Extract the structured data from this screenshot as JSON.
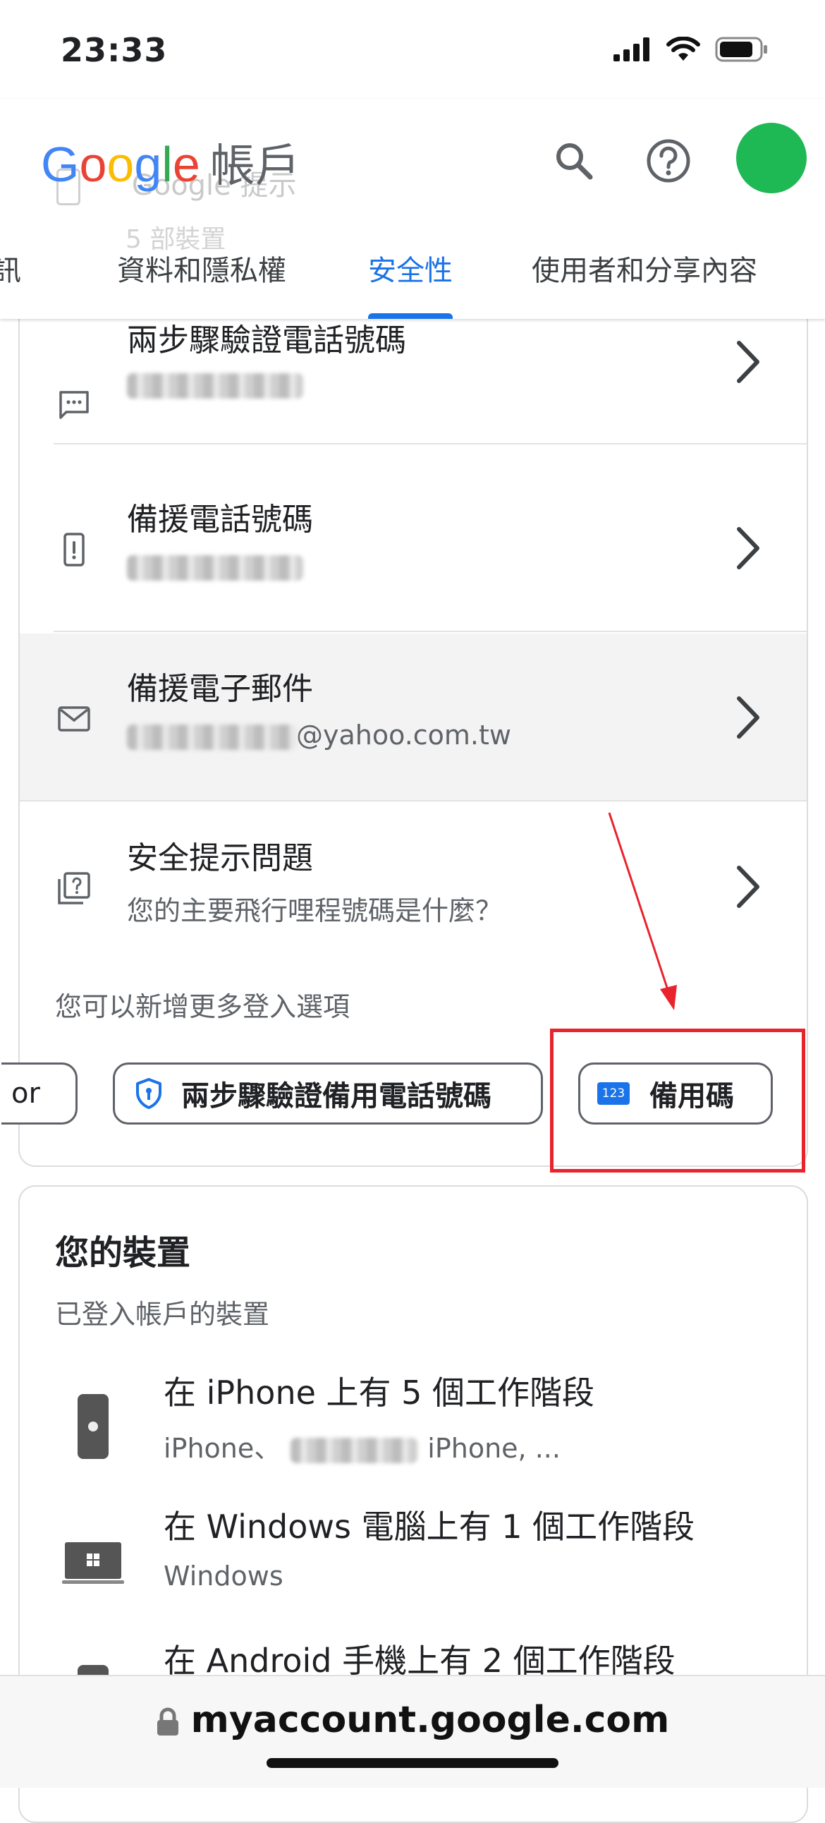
{
  "status_bar": {
    "time": "23:33"
  },
  "header": {
    "logo_letters": [
      {
        "ch": "G",
        "color": "#4285F4"
      },
      {
        "ch": "o",
        "color": "#EA4335"
      },
      {
        "ch": "o",
        "color": "#FBBC05"
      },
      {
        "ch": "g",
        "color": "#4285F4"
      },
      {
        "ch": "l",
        "color": "#34A853"
      },
      {
        "ch": "e",
        "color": "#EA4335"
      }
    ],
    "account_label": "帳戶",
    "ghost_title": "Google 提示",
    "ghost_sub": "5 部裝置",
    "avatar_color": "#1eb854"
  },
  "tabs": [
    {
      "label": "訊"
    },
    {
      "label": "資料和隱私權"
    },
    {
      "label": "安全性",
      "active": true
    },
    {
      "label": "使用者和分享內容"
    }
  ],
  "signin_rows": [
    {
      "title": "兩步驟驗證電話號碼",
      "icon": "sms-icon"
    },
    {
      "title": "備援電話號碼",
      "icon": "phone-alert-icon"
    },
    {
      "title": "備援電子郵件",
      "subtitle_suffix": "@yahoo.com.tw",
      "icon": "mail-icon"
    },
    {
      "title": "安全提示問題",
      "subtitle": "您的主要飛行哩程號碼是什麼？",
      "icon": "security-question-icon"
    }
  ],
  "add_more_note": "您可以新增更多登入選項",
  "chips": [
    {
      "label": "or"
    },
    {
      "label": "兩步驟驗證備用電話號碼"
    },
    {
      "label": "備用碼",
      "badge": "123"
    }
  ],
  "devices_card": {
    "title": "您的裝置",
    "subtitle": "已登入帳戶的裝置",
    "devices": [
      {
        "title": "在 iPhone 上有 5 個工作階段",
        "subtitle_a": "iPhone、",
        "subtitle_b": "iPhone, ..."
      },
      {
        "title": "在 Windows 電腦上有 1 個工作階段",
        "subtitle": "Windows"
      },
      {
        "title": "在 Android 手機上有 2 個工作階段"
      }
    ]
  },
  "browser": {
    "url": "myaccount.google.com"
  }
}
